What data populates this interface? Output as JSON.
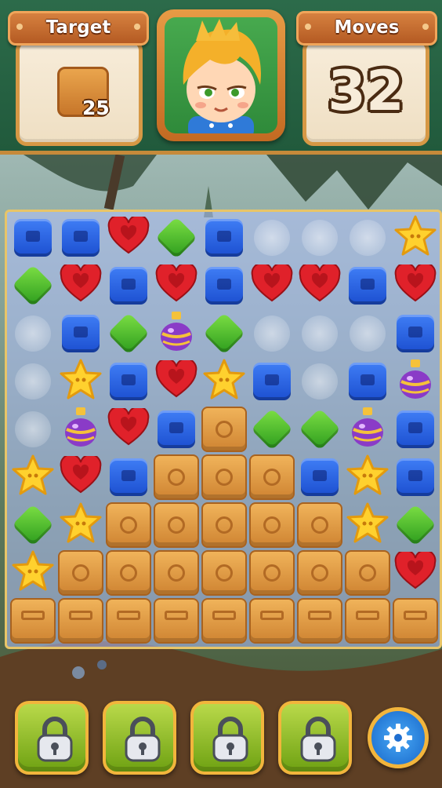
{
  "hud": {
    "target_label": "Target",
    "target_count": "25",
    "target_icon": "crate-icon",
    "moves_label": "Moves",
    "moves_value": "32",
    "avatar": "character-avatar"
  },
  "board": {
    "rows": 9,
    "cols": 9,
    "grid": [
      [
        "blue",
        "blue",
        "heart",
        "green",
        "blue",
        "empty",
        "empty",
        "empty",
        "star"
      ],
      [
        "green",
        "heart",
        "blue",
        "heart",
        "blue",
        "heart",
        "heart",
        "blue",
        "heart"
      ],
      [
        "empty",
        "blue",
        "green",
        "potion",
        "green",
        "empty",
        "empty",
        "empty",
        "blue"
      ],
      [
        "empty",
        "star",
        "blue",
        "heart",
        "star",
        "blue",
        "empty",
        "blue",
        "potion"
      ],
      [
        "empty",
        "potion",
        "heart",
        "blue",
        "crate",
        "green",
        "green",
        "potion",
        "blue"
      ],
      [
        "star",
        "heart",
        "blue",
        "crate",
        "crate",
        "crate",
        "blue",
        "star",
        "blue"
      ],
      [
        "green",
        "star",
        "crate",
        "crate",
        "crate",
        "crate",
        "crate",
        "star",
        "green"
      ],
      [
        "star",
        "crate",
        "crate",
        "crate",
        "crate",
        "crate",
        "crate",
        "crate",
        "heart"
      ],
      [
        "base",
        "base",
        "base",
        "base",
        "base",
        "base",
        "base",
        "base",
        "base"
      ]
    ]
  },
  "boosters": [
    {
      "icon": "lock-icon",
      "locked": true
    },
    {
      "icon": "lock-icon",
      "locked": true
    },
    {
      "icon": "lock-icon",
      "locked": true
    },
    {
      "icon": "lock-icon",
      "locked": true
    }
  ],
  "settings_icon": "gear-icon",
  "colors": {
    "header_bg": "#2c6b4a",
    "banner": "#c76b2c",
    "board_frame": "#e8c568",
    "booster": "#8bbd23"
  }
}
